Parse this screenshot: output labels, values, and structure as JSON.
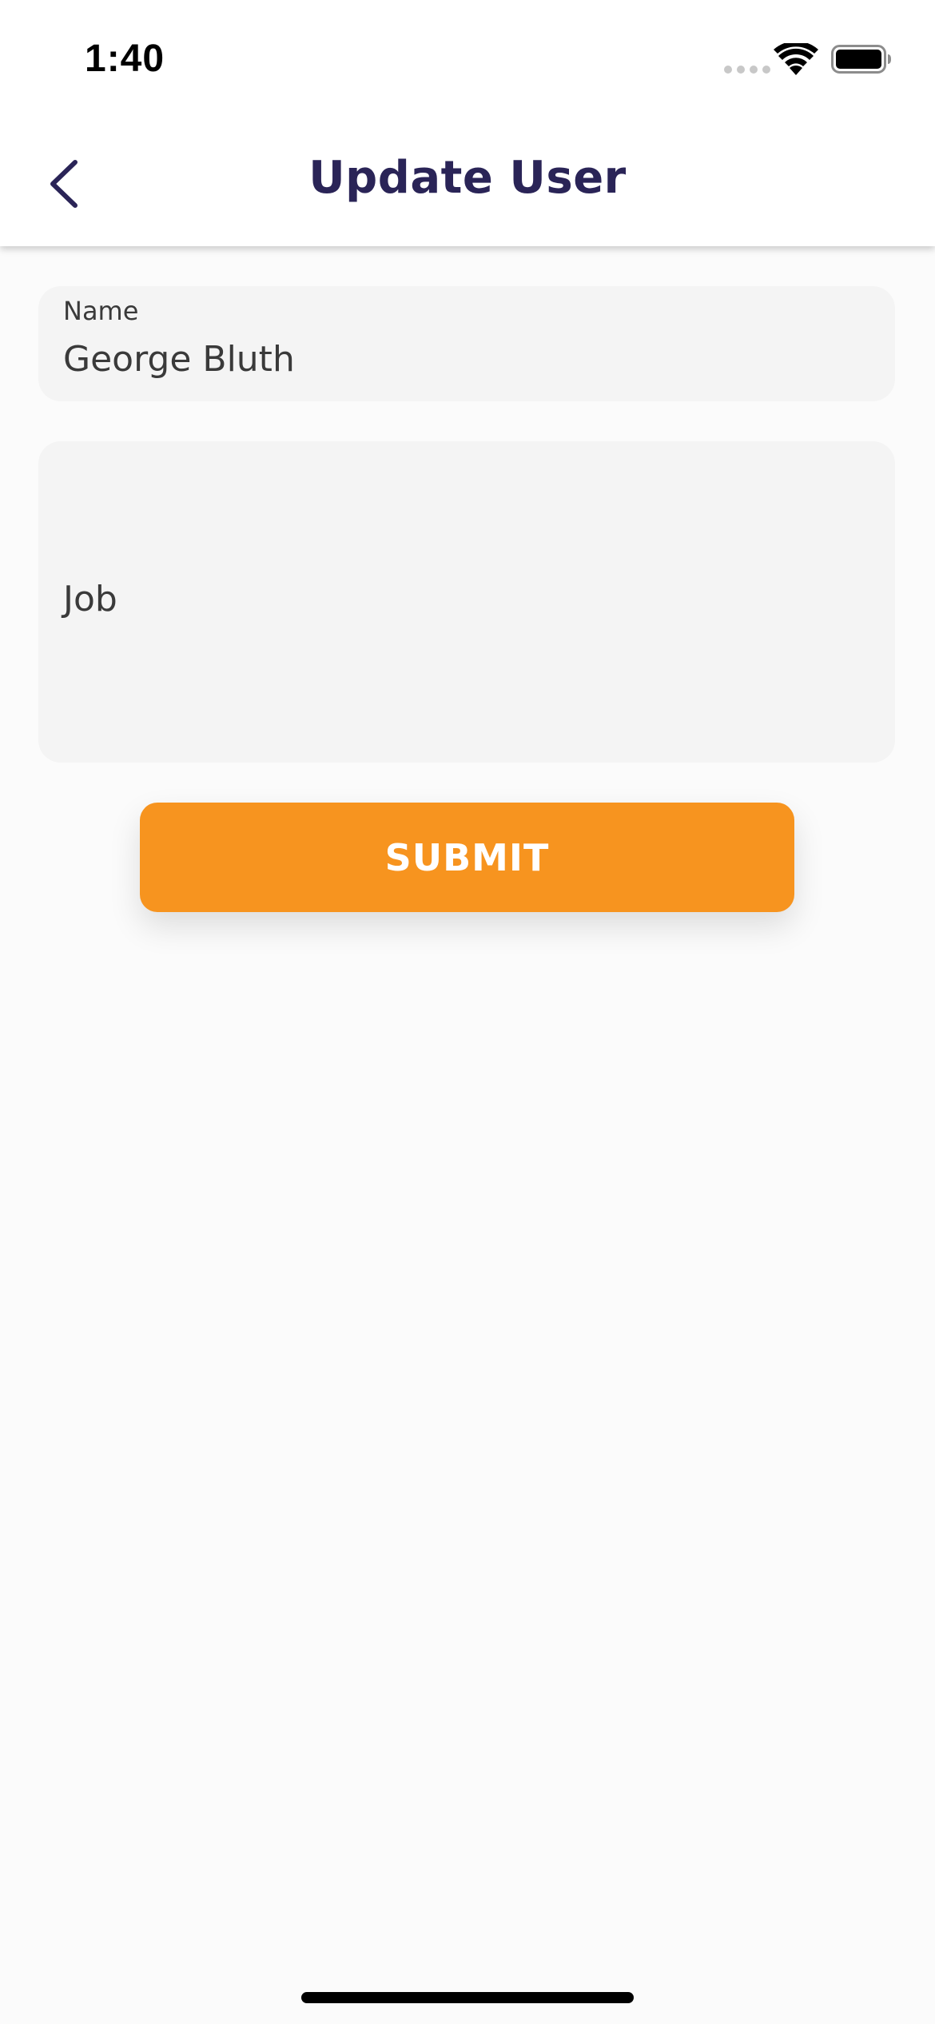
{
  "status_bar": {
    "time": "1:40"
  },
  "header": {
    "title": "Update User",
    "back_icon": "chevron-left-icon"
  },
  "form": {
    "name": {
      "label": "Name",
      "value": "George Bluth"
    },
    "job": {
      "label": "Job",
      "value": ""
    },
    "submit_label": "SUBMIT"
  },
  "colors": {
    "accent": "#f7941f",
    "title": "#2a2457",
    "field_bg": "#f4f4f4",
    "page_bg": "#fbfbfb"
  }
}
